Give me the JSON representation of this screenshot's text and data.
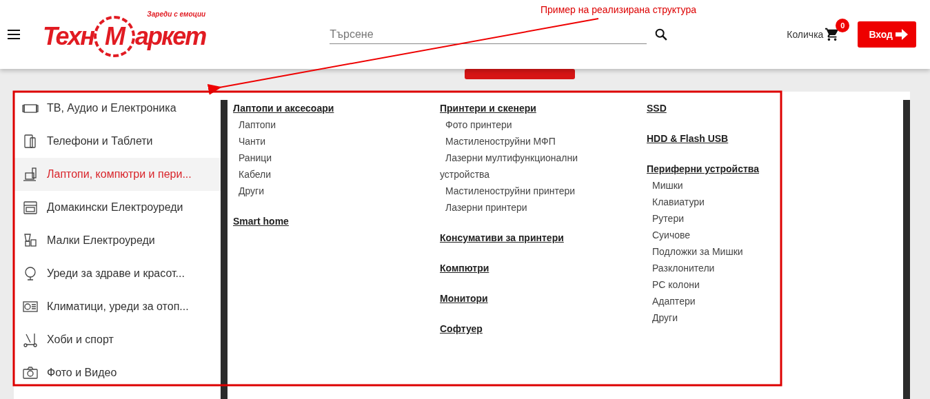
{
  "annotation": {
    "text": "Пример на реализирана структура"
  },
  "header": {
    "logo": {
      "prefix": "Техн",
      "circled": "М",
      "suffix": "аркет",
      "slogan": "Зареди с емоции"
    },
    "search": {
      "placeholder": "Търсене"
    },
    "cart": {
      "label": "Количка",
      "count": "0"
    },
    "login": {
      "label": "Вход"
    }
  },
  "categories": [
    {
      "label": "ТВ, Аудио и Електроника",
      "selected": false
    },
    {
      "label": "Телефони и Таблети",
      "selected": false
    },
    {
      "label": "Лаптопи, компютри и пери...",
      "selected": true
    },
    {
      "label": "Домакински Електроуреди",
      "selected": false
    },
    {
      "label": "Малки Електроуреди",
      "selected": false
    },
    {
      "label": "Уреди за здраве и красот...",
      "selected": false
    },
    {
      "label": "Климатици, уреди за отоп...",
      "selected": false
    },
    {
      "label": "Хоби и спорт",
      "selected": false
    },
    {
      "label": "Фото и Видео",
      "selected": false
    }
  ],
  "columns": [
    [
      {
        "title": "Лаптопи и аксесоари",
        "items": [
          "Лаптопи",
          "Чанти",
          "Раници",
          "Кабели",
          "Други"
        ]
      },
      {
        "title": "Smart home"
      }
    ],
    [
      {
        "title": "Принтери и скенери",
        "items": [
          "Фото принтери",
          "Мастиленоструйни МФП",
          "Лазерни мултифункционални устройства",
          "Мастиленоструйни принтери",
          "Лазерни принтери"
        ]
      },
      {
        "title": "Консумативи за принтери"
      },
      {
        "title": "Компютри"
      },
      {
        "title": "Монитори"
      },
      {
        "title": "Софтуер"
      }
    ],
    [
      {
        "title": "SSD"
      },
      {
        "title": "HDD & Flash USB"
      },
      {
        "title": "Периферни устройства",
        "items": [
          "Мишки",
          "Клавиатури",
          "Рутери",
          "Суичове",
          "Подложки за Мишки",
          "Разклонители",
          "PC колони",
          "Адаптери",
          "Други"
        ]
      }
    ]
  ]
}
